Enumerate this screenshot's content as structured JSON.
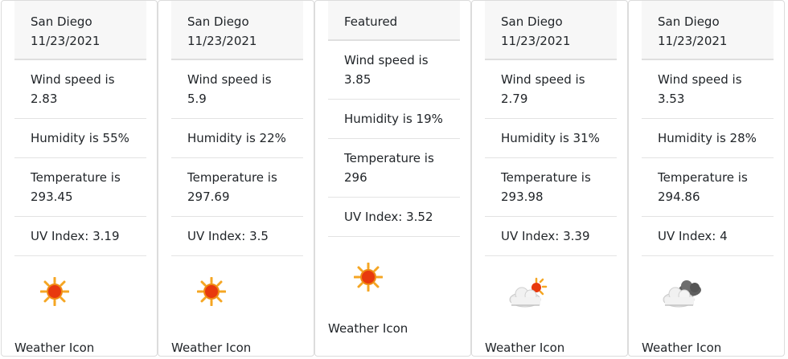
{
  "cards": [
    {
      "header": [
        "San Diego",
        "11/23/2021"
      ],
      "items": [
        [
          "Wind speed is",
          "2.83"
        ],
        [
          "Humidity is 55%"
        ],
        [
          "Temperature is",
          "293.45"
        ],
        [
          "UV Index: 3.19"
        ]
      ],
      "icon": "sun-icon",
      "icon_label": "Weather Icon"
    },
    {
      "header": [
        "San Diego",
        "11/23/2021"
      ],
      "items": [
        [
          "Wind speed is",
          "5.9"
        ],
        [
          "Humidity is 22%"
        ],
        [
          "Temperature is",
          "297.69"
        ],
        [
          "UV Index: 3.5"
        ]
      ],
      "icon": "sun-icon",
      "icon_label": "Weather Icon"
    },
    {
      "header": [
        "Featured"
      ],
      "items": [
        [
          "Wind speed is",
          "3.85"
        ],
        [
          "Humidity is 19%"
        ],
        [
          "Temperature is",
          "296"
        ],
        [
          "UV Index: 3.52"
        ]
      ],
      "icon": "sun-icon",
      "icon_label": "Weather Icon"
    },
    {
      "header": [
        "San Diego",
        "11/23/2021"
      ],
      "items": [
        [
          "Wind speed is",
          "2.79"
        ],
        [
          "Humidity is 31%"
        ],
        [
          "Temperature is",
          "293.98"
        ],
        [
          "UV Index: 3.39"
        ]
      ],
      "icon": "partly-cloudy-icon",
      "icon_label": "Weather Icon"
    },
    {
      "header": [
        "San Diego",
        "11/23/2021"
      ],
      "items": [
        [
          "Wind speed is",
          "3.53"
        ],
        [
          "Humidity is 28%"
        ],
        [
          "Temperature is",
          "294.86"
        ],
        [
          "UV Index: 4"
        ]
      ],
      "icon": "cloudy-icon",
      "icon_label": "Weather Icon"
    }
  ],
  "colors": {
    "header_bg": "#f7f7f7",
    "border": "#dcdcdc",
    "sun": "#e8390e",
    "sun_rays": "#f5a623"
  }
}
